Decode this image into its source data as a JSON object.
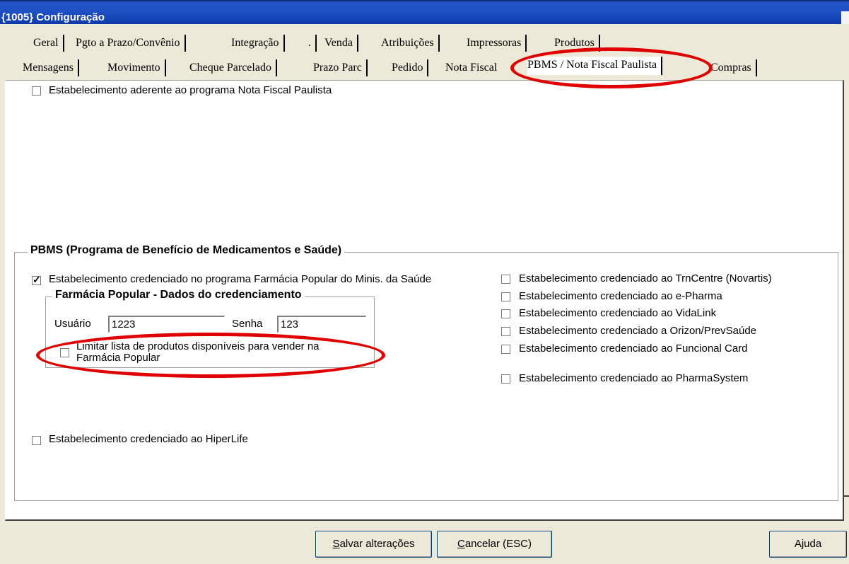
{
  "window": {
    "title": "{1005} Configuração"
  },
  "tabs_row1": [
    "Geral",
    "Pgto a Prazo/Convênio",
    "Integração",
    ".",
    "Venda",
    "Atribuições",
    "Impressoras",
    "Produtos"
  ],
  "tabs_row2": [
    "Mensagens",
    "Movimento",
    "Cheque Parcelado",
    "Prazo Parc",
    "Pedido",
    "Nota Fiscal",
    "PBMS / Nota Fiscal Paulista",
    "Compras"
  ],
  "active_tab": "PBMS / Nota Fiscal Paulista",
  "nfp": {
    "checkbox_label": "Estabelecimento aderente ao programa Nota Fiscal Paulista",
    "checked": false
  },
  "pbms": {
    "legend": "PBMS (Programa de Benefício de Medicamentos e Saúde)",
    "farmacia_popular": {
      "label": "Estabelecimento credenciado no programa Farmácia Popular do Minis. da Saúde",
      "checked": true
    },
    "credenciamento": {
      "legend": "Farmácia Popular - Dados do credenciamento",
      "usuario_label": "Usuário",
      "usuario_value": "1223",
      "senha_label": "Senha",
      "senha_value": "123",
      "limitar_label_line1": "Limitar lista de produtos disponíveis para vender na",
      "limitar_label_line2": "Farmácia Popular",
      "limitar_checked": false
    },
    "others": [
      {
        "label": "Estabelecimento credenciado ao TrnCentre (Novartis)",
        "checked": false
      },
      {
        "label": "Estabelecimento credenciado ao e-Pharma",
        "checked": false
      },
      {
        "label": "Estabelecimento credenciado ao VidaLink",
        "checked": false
      },
      {
        "label": "Estabelecimento credenciado a Orizon/PrevSaúde",
        "checked": false
      },
      {
        "label": "Estabelecimento credenciado ao Funcional Card",
        "checked": false
      },
      {
        "label": "Estabelecimento credenciado ao PharmaSystem",
        "checked": false
      }
    ],
    "hiperlife": {
      "label": "Estabelecimento credenciado ao HiperLife",
      "checked": false
    }
  },
  "buttons": {
    "save": "alvar alterações",
    "save_accel": "S",
    "cancel": "ancelar (ESC)",
    "cancel_accel": "C",
    "help": "Ajuda"
  },
  "colors": {
    "highlight_ellipse": "#e00000",
    "titlebar": "#1e50c4"
  }
}
